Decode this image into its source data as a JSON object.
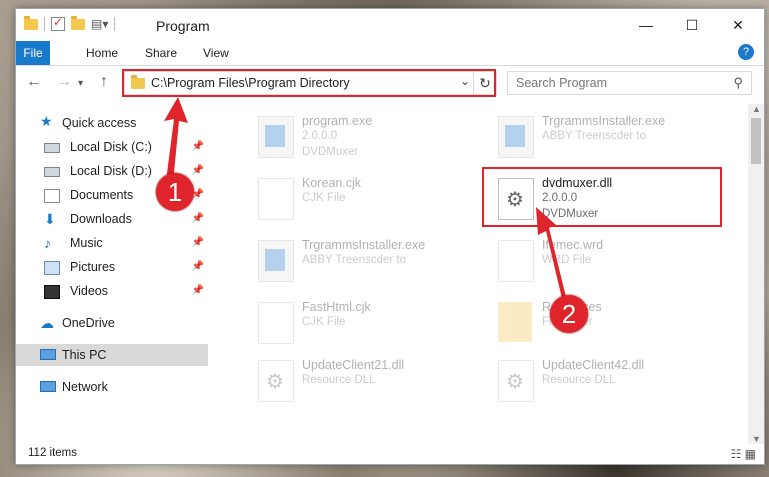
{
  "window": {
    "title": "Program",
    "controls": {
      "minimize": "—",
      "maximize": "☐",
      "close": "✕"
    }
  },
  "ribbon": {
    "tabs": [
      "File",
      "Home",
      "Share",
      "View"
    ]
  },
  "nav": {
    "address": "C:\\Program Files\\Program Directory",
    "search_placeholder": "Search Program"
  },
  "sidebar": {
    "items": [
      {
        "label": "Quick access",
        "icon": "star-icon",
        "pinned": false
      },
      {
        "label": "Local Disk (C:)",
        "icon": "drive-icon",
        "pinned": true
      },
      {
        "label": "Local Disk (D:)",
        "icon": "drive-icon",
        "pinned": true
      },
      {
        "label": "Documents",
        "icon": "documents-icon",
        "pinned": true
      },
      {
        "label": "Downloads",
        "icon": "download-icon",
        "pinned": true
      },
      {
        "label": "Music",
        "icon": "music-icon",
        "pinned": true
      },
      {
        "label": "Pictures",
        "icon": "pictures-icon",
        "pinned": true
      },
      {
        "label": "Videos",
        "icon": "videos-icon",
        "pinned": true
      },
      {
        "label": "OneDrive",
        "icon": "cloud-icon",
        "pinned": false
      },
      {
        "label": "This PC",
        "icon": "computer-icon",
        "pinned": false
      },
      {
        "label": "Network",
        "icon": "network-icon",
        "pinned": false
      }
    ]
  },
  "files": [
    {
      "name": "program.exe",
      "line1": "2.0.0.0",
      "line2": "DVDMuxer"
    },
    {
      "name": "TrgrammsInstaller.exe",
      "line1": "ABBY Treenscder to",
      "line2": ""
    },
    {
      "name": "Korean.cjk",
      "line1": "CJK File",
      "line2": ""
    },
    {
      "name": "dvdmuxer.dll",
      "line1": "2.0.0.0",
      "line2": "DVDMuxer"
    },
    {
      "name": "TrgrammsInstaller.exe",
      "line1": "ABBY Treenscder to",
      "line2": ""
    },
    {
      "name": "Ifemec.wrd",
      "line1": "WRD File",
      "line2": ""
    },
    {
      "name": "FastHtml.cjk",
      "line1": "CJK File",
      "line2": ""
    },
    {
      "name": "Resources",
      "line1": "File folder",
      "line2": ""
    },
    {
      "name": "UpdateClient21.dll",
      "line1": "Resource DLL",
      "line2": ""
    },
    {
      "name": "UpdateClient42.dll",
      "line1": "Resource DLL",
      "line2": ""
    }
  ],
  "status": {
    "item_count": "112 items"
  },
  "annotations": {
    "step1": "1",
    "step2": "2",
    "accent": "#e0242c"
  }
}
